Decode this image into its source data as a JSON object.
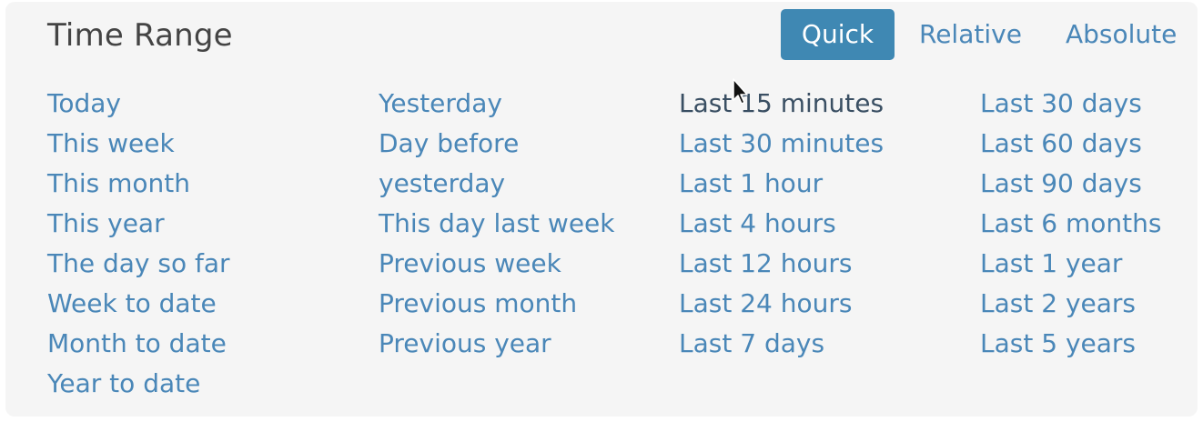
{
  "header": {
    "title": "Time Range"
  },
  "tabs": [
    {
      "label": "Quick",
      "selected": true
    },
    {
      "label": "Relative",
      "selected": false
    },
    {
      "label": "Absolute",
      "selected": false
    }
  ],
  "columns": [
    [
      "Today",
      "This week",
      "This month",
      "This year",
      "The day so far",
      "Week to date",
      "Month to date",
      "Year to date"
    ],
    [
      "Yesterday",
      "Day before",
      "yesterday",
      "This day last week",
      "Previous week",
      "Previous month",
      "Previous year"
    ],
    [
      "Last 15 minutes",
      "Last 30 minutes",
      "Last 1 hour",
      "Last 4 hours",
      "Last 12 hours",
      "Last 24 hours",
      "Last 7 days"
    ],
    [
      "Last 30 days",
      "Last 60 days",
      "Last 90 days",
      "Last 6 months",
      "Last 1 year",
      "Last 2 years",
      "Last 5 years"
    ]
  ],
  "colors": {
    "link": "#4a87b8",
    "hovered_link": "#3a4f63",
    "selected_tab_bg": "#3f88b3",
    "title": "#444444"
  },
  "icons": {
    "cursor": "mouse-pointer-icon"
  }
}
